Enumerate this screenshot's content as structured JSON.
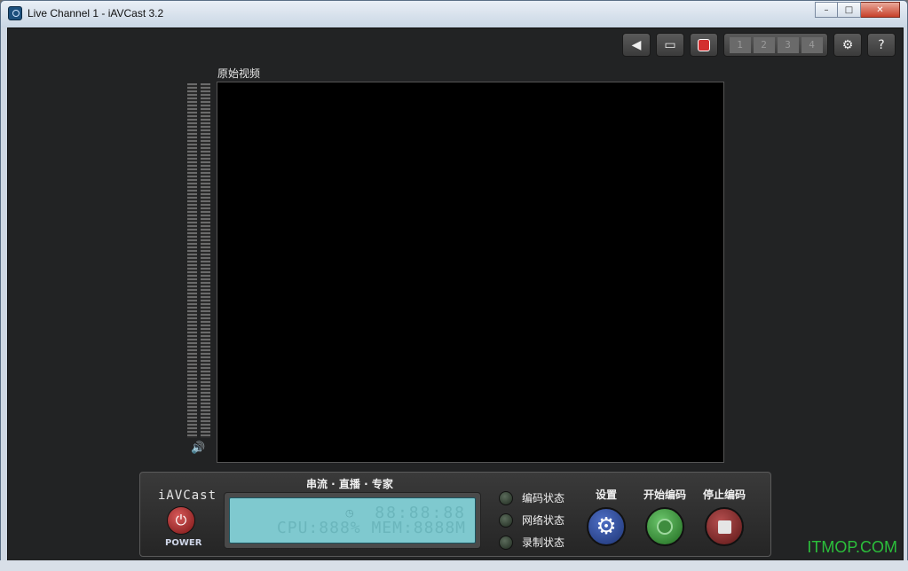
{
  "window": {
    "title": "Live Channel 1 - iAVCast 3.2"
  },
  "titlebar": {
    "min": "–",
    "max": "□",
    "close": "✕"
  },
  "toolbar": {
    "sound": "◀",
    "display": "▭",
    "help": "?",
    "settings": "⚙",
    "channels": [
      "1",
      "2",
      "3",
      "4"
    ]
  },
  "video": {
    "label": "原始视频"
  },
  "panel": {
    "brand": "iAVCast",
    "power_label": "POWER",
    "slogan": "串流 · 直播 · 专家",
    "lcd_time": "88:88:88",
    "lcd_stats": "CPU:888% MEM:8888M",
    "status": [
      "编码状态",
      "网络状态",
      "录制状态"
    ],
    "settings_label": "设置",
    "start_label": "开始编码",
    "stop_label": "停止编码"
  },
  "watermark": "ITMOP.COM"
}
